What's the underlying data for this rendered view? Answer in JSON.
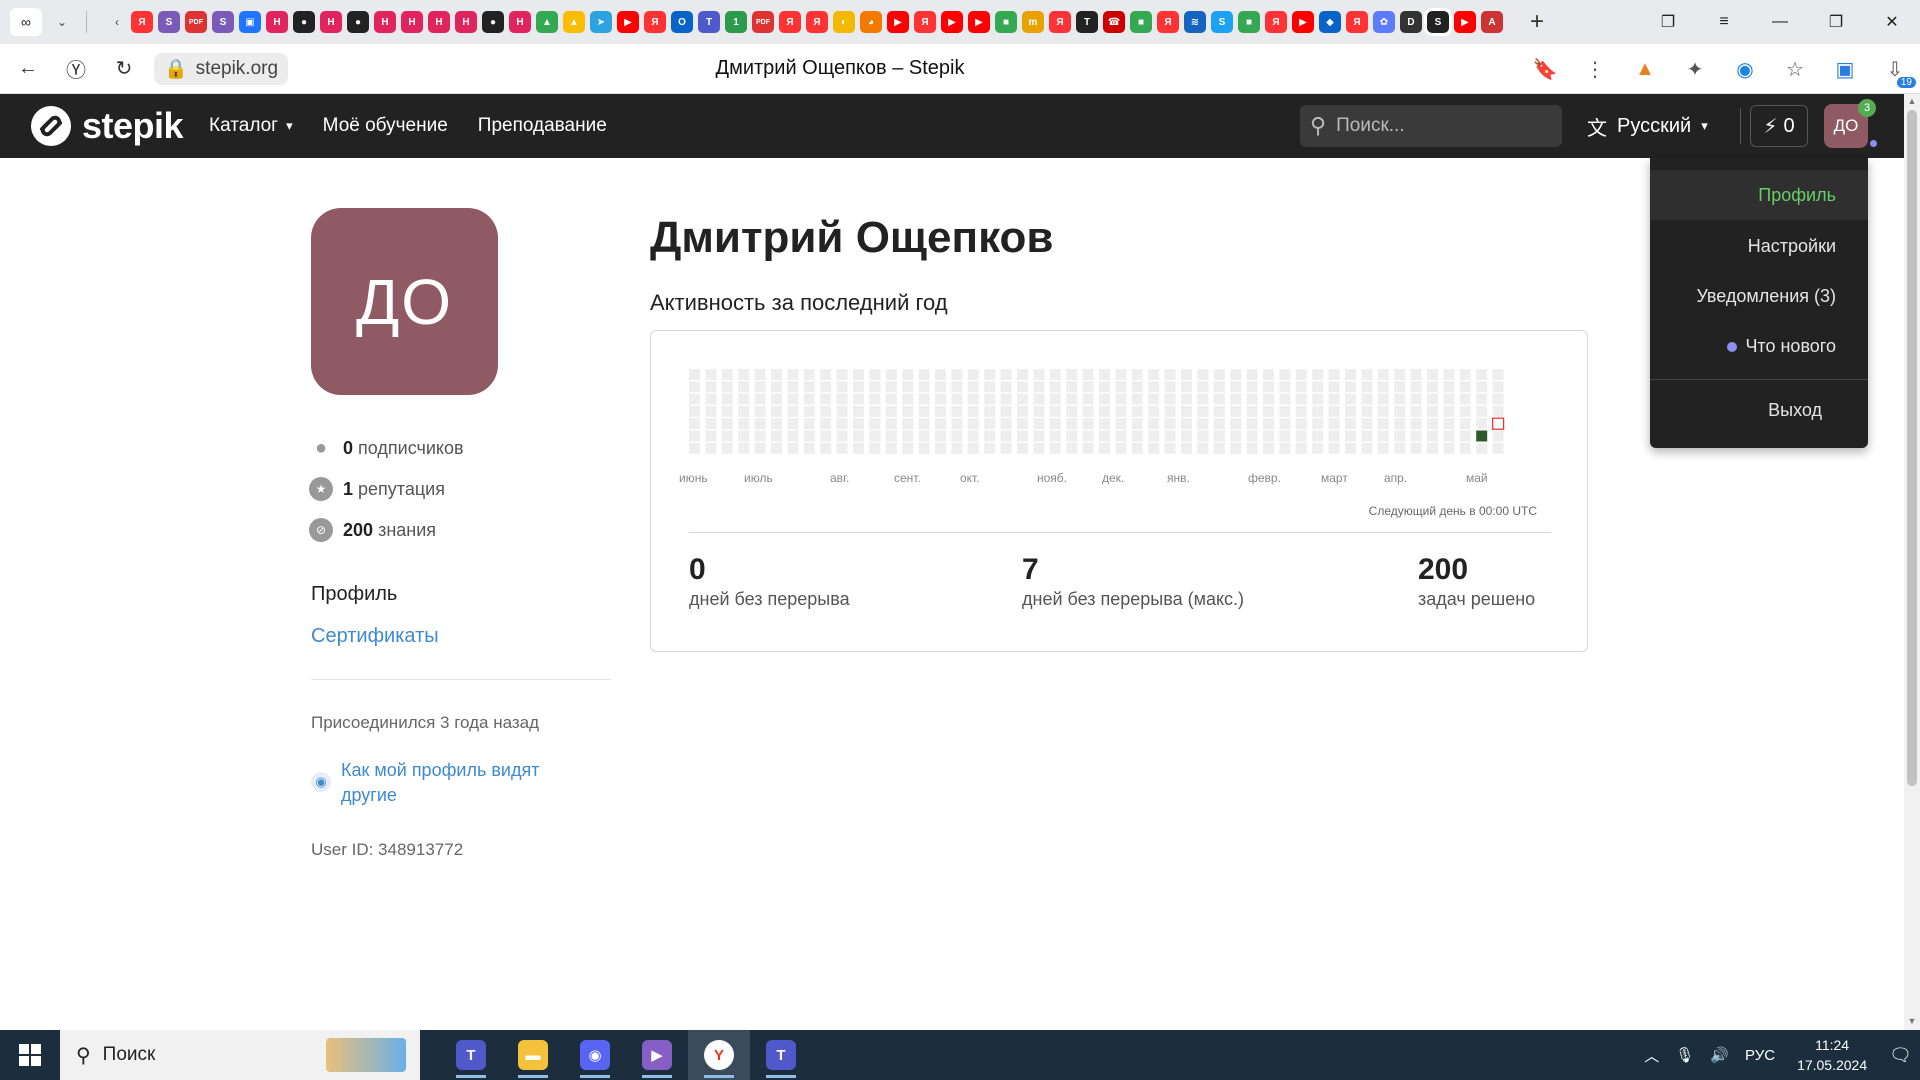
{
  "browser": {
    "tab_favicons": [
      {
        "glyph": "Я",
        "color": "#f33"
      },
      {
        "glyph": "S",
        "color": "#7a5bb8"
      },
      {
        "glyph": "PDF",
        "color": "#d33"
      },
      {
        "glyph": "S",
        "color": "#7a5bb8"
      },
      {
        "glyph": "▣",
        "color": "#1f75fe"
      },
      {
        "glyph": "H",
        "color": "#e0245e"
      },
      {
        "glyph": "●",
        "color": "#222"
      },
      {
        "glyph": "H",
        "color": "#e0245e"
      },
      {
        "glyph": "●",
        "color": "#222"
      },
      {
        "glyph": "H",
        "color": "#e0245e"
      },
      {
        "glyph": "H",
        "color": "#e0245e"
      },
      {
        "glyph": "H",
        "color": "#e0245e"
      },
      {
        "glyph": "H",
        "color": "#e0245e"
      },
      {
        "glyph": "●",
        "color": "#222"
      },
      {
        "glyph": "H",
        "color": "#e0245e"
      },
      {
        "glyph": "▲",
        "color": "#34a853"
      },
      {
        "glyph": "▲",
        "color": "#fbbc04"
      },
      {
        "glyph": "➤",
        "color": "#2aa3e0"
      },
      {
        "glyph": "▶",
        "color": "#f00"
      },
      {
        "glyph": "Я",
        "color": "#f33"
      },
      {
        "glyph": "O",
        "color": "#0a64c8"
      },
      {
        "glyph": "T",
        "color": "#5059c9"
      },
      {
        "glyph": "1",
        "color": "#2c9b4b"
      },
      {
        "glyph": "PDF",
        "color": "#d33"
      },
      {
        "glyph": "Я",
        "color": "#f33"
      },
      {
        "glyph": "Я",
        "color": "#f33"
      },
      {
        "glyph": "◐",
        "color": "#f3b800"
      },
      {
        "glyph": "◕",
        "color": "#f37a00"
      },
      {
        "glyph": "▶",
        "color": "#f00"
      },
      {
        "glyph": "Я",
        "color": "#f33"
      },
      {
        "glyph": "▶",
        "color": "#f00"
      },
      {
        "glyph": "▶",
        "color": "#f00"
      },
      {
        "glyph": "■",
        "color": "#34a853"
      },
      {
        "glyph": "m",
        "color": "#e8a200"
      },
      {
        "glyph": "Я",
        "color": "#f33"
      },
      {
        "glyph": "T",
        "color": "#222"
      },
      {
        "glyph": "☎",
        "color": "#c00"
      },
      {
        "glyph": "■",
        "color": "#34a853"
      },
      {
        "glyph": "Я",
        "color": "#f33"
      },
      {
        "glyph": "≋",
        "color": "#1565c0"
      },
      {
        "glyph": "S",
        "color": "#1da1f2"
      },
      {
        "glyph": "■",
        "color": "#34a853"
      },
      {
        "glyph": "Я",
        "color": "#f33"
      },
      {
        "glyph": "▶",
        "color": "#f00"
      },
      {
        "glyph": "◆",
        "color": "#0a64c8"
      },
      {
        "glyph": "Я",
        "color": "#f33"
      },
      {
        "glyph": "✿",
        "color": "#5c7cfa"
      },
      {
        "glyph": "D",
        "color": "#333"
      },
      {
        "glyph": "S",
        "color": "#222"
      },
      {
        "glyph": "▶",
        "color": "#f00"
      },
      {
        "glyph": "A",
        "color": "#c33"
      }
    ],
    "active_tab_index": 48,
    "url": "stepik.org",
    "title": "Дмитрий Ощепков – Stepik",
    "extension_badge": "19"
  },
  "site": {
    "logo_text": "stepik",
    "nav": {
      "catalog": "Каталог",
      "my_learning": "Моё обучение",
      "teaching": "Преподавание"
    },
    "search_placeholder": "Поиск...",
    "language": "Русский",
    "energy_count": "0",
    "avatar_initials": "ДО",
    "notification_count": "3"
  },
  "user_menu": {
    "profile": "Профиль",
    "settings": "Настройки",
    "notifications": "Уведомления (3)",
    "whats_new": "Что нового",
    "logout": "Выход",
    "active_color": "#66cc66"
  },
  "profile": {
    "initials": "ДО",
    "name": "Дмитрий Ощепков",
    "stats": {
      "followers_value": "0",
      "followers_label": "подписчиков",
      "reputation_value": "1",
      "reputation_label": "репутация",
      "knowledge_value": "200",
      "knowledge_label": "знания"
    },
    "side_links": {
      "profile": "Профиль",
      "certificates": "Сертификаты"
    },
    "joined": "Присоединился 3 года назад",
    "how_others_see": "Как мой профиль видят другие",
    "user_id": "User ID: 348913772"
  },
  "activity": {
    "title": "Активность за последний год",
    "months": [
      "июнь",
      "июль",
      "авг.",
      "сент.",
      "окт.",
      "нояб.",
      "дек.",
      "янв.",
      "февр.",
      "март",
      "апр.",
      "май"
    ],
    "next_day_note": "Следующий день в 00:00 UTC",
    "weeks": 50,
    "active_cell": {
      "week": 48,
      "day": 5
    },
    "today_cell": {
      "week": 49,
      "day": 4
    },
    "colors": {
      "empty": "#eeeeee",
      "active": "#2d5a2d",
      "today_border": "#e03a3a"
    },
    "kpis": [
      {
        "value": "0",
        "label": "дней без перерыва"
      },
      {
        "value": "7",
        "label": "дней без перерыва (макс.)"
      },
      {
        "value": "200",
        "label": "задач решено"
      }
    ]
  },
  "taskbar": {
    "search_label": "Поиск",
    "apps": [
      {
        "name": "teams",
        "glyph": "T",
        "color": "#5059c9"
      },
      {
        "name": "explorer",
        "glyph": "▬",
        "color": "#f3c13a"
      },
      {
        "name": "discord",
        "glyph": "◉",
        "color": "#5865f2"
      },
      {
        "name": "visual-studio",
        "glyph": "▶",
        "color": "#865fc5"
      },
      {
        "name": "yandex-browser",
        "glyph": "Y",
        "color": "#fff"
      },
      {
        "name": "teams-2",
        "glyph": "T",
        "color": "#5059c9"
      }
    ],
    "language": "РУС",
    "time": "11:24",
    "date": "17.05.2024"
  }
}
